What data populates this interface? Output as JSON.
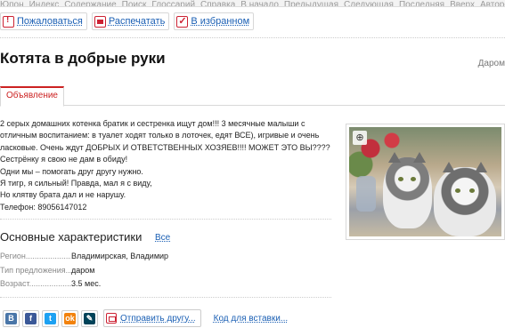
{
  "topnav": [
    "Юпон",
    "Индекс",
    "Содержание",
    "Поиск",
    "Глоссарий",
    "Справка",
    "В начало",
    "Предыдущая",
    "Следующая",
    "Последняя",
    "Вверх",
    "Авторские права"
  ],
  "actions": {
    "complain": "Пожаловаться",
    "print": "Распечатать",
    "favorites": "В избранном"
  },
  "listing": {
    "title": "Котята в добрые руки",
    "price_type": "Даром"
  },
  "tabs": [
    "Объявление"
  ],
  "description": [
    "2 серых домашних котенка братик и сестренка ищут дом!!! 3 месячные малыши с",
    "отличным воспитанием: в туалет ходят только в лоточек, едят ВСЕ), игривые и очень",
    "ласковые. Очень ждут ДОБРЫХ И ОТВЕТСТВЕННЫХ ХОЗЯЕВ!!!! МОЖЕТ ЭТО ВЫ????",
    "Сестрёнку я свою не дам в обиду!",
    "Одни мы – помогать друг другу нужно.",
    "Я тигр, я сильный! Правда, мал я с виду,",
    "Но клятву брата дал и не нарушу.",
    "Телефон: 89056147012"
  ],
  "characteristics": {
    "title": "Основные характеристики",
    "all_link": "Все",
    "rows": [
      {
        "key": "Регион......................",
        "value": "Владимирская, Владимир"
      },
      {
        "key": "Тип предложения..........",
        "value": "даром"
      },
      {
        "key": "Возраст......................",
        "value": "3.5 мес."
      }
    ]
  },
  "share": {
    "buttons": [
      {
        "name": "vk",
        "glyph": "B",
        "color": "#4a76a8"
      },
      {
        "name": "facebook",
        "glyph": "f",
        "color": "#3b5998"
      },
      {
        "name": "twitter",
        "glyph": "t",
        "color": "#1da1f2"
      },
      {
        "name": "odnoklassniki",
        "glyph": "ok",
        "color": "#f2820d"
      },
      {
        "name": "livejournal",
        "glyph": "✎",
        "color": "#004359"
      }
    ],
    "send_friend": "Отправить другу...",
    "embed_code": "Код для вставки..."
  }
}
